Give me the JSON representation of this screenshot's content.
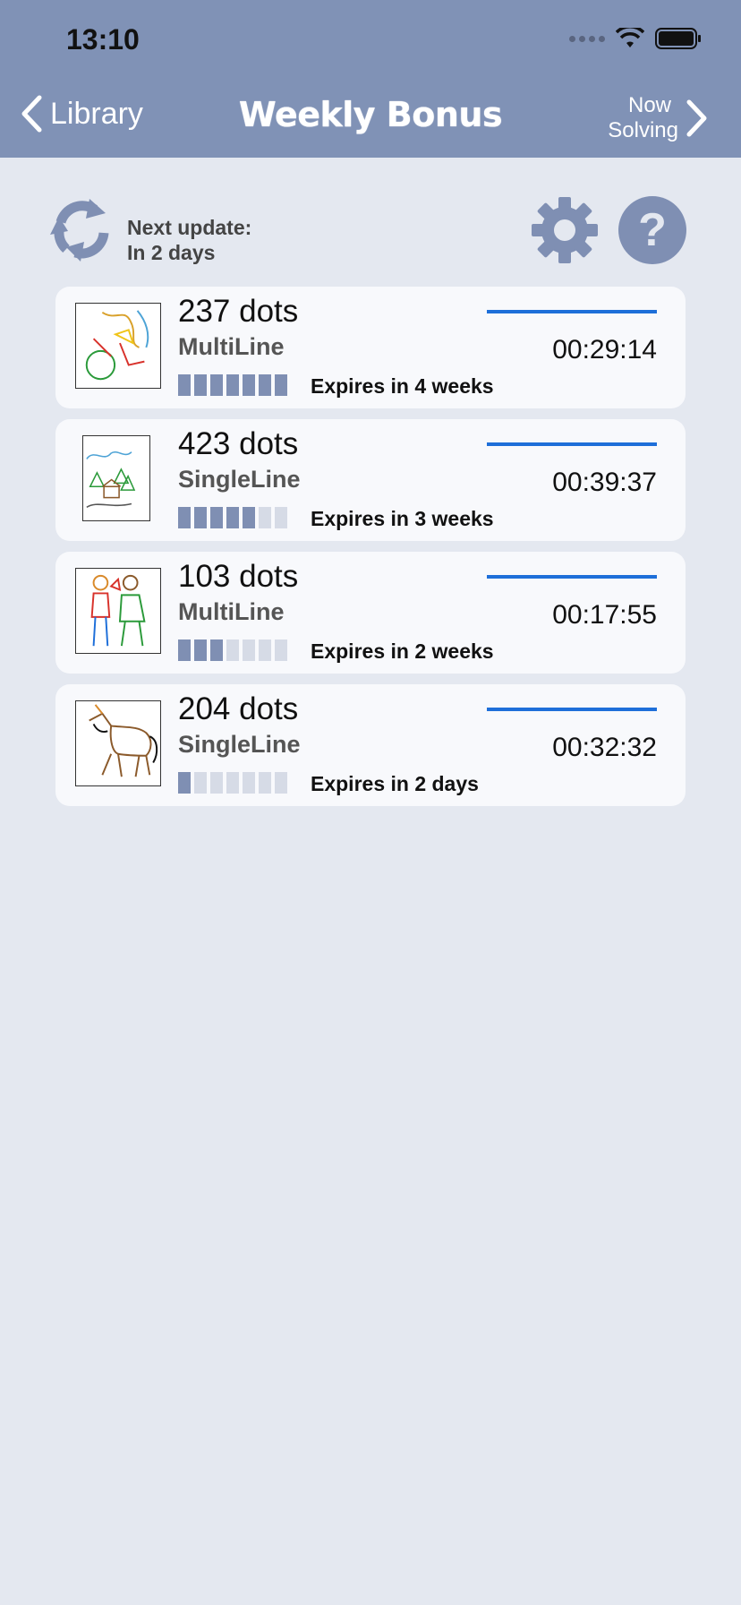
{
  "status_bar": {
    "time": "13:10"
  },
  "nav": {
    "back_label": "Library",
    "title": "Weekly Bonus",
    "forward_line1": "Now",
    "forward_line2": "Solving"
  },
  "toolbar": {
    "update_line1": "Next update:",
    "update_line2": "In 2 days"
  },
  "puzzles": [
    {
      "dots": "237 dots",
      "mode": "MultiLine",
      "time": "00:29:14",
      "expires": "Expires in 4 weeks",
      "level": 7
    },
    {
      "dots": "423 dots",
      "mode": "SingleLine",
      "time": "00:39:37",
      "expires": "Expires in 3 weeks",
      "level": 5
    },
    {
      "dots": "103 dots",
      "mode": "MultiLine",
      "time": "00:17:55",
      "expires": "Expires in 2 weeks",
      "level": 3
    },
    {
      "dots": "204 dots",
      "mode": "SingleLine",
      "time": "00:32:32",
      "expires": "Expires in 2 days",
      "level": 1
    }
  ],
  "colors": {
    "header": "#8092b6",
    "accent_line": "#1e6fd9",
    "icon": "#7f8fb3"
  }
}
